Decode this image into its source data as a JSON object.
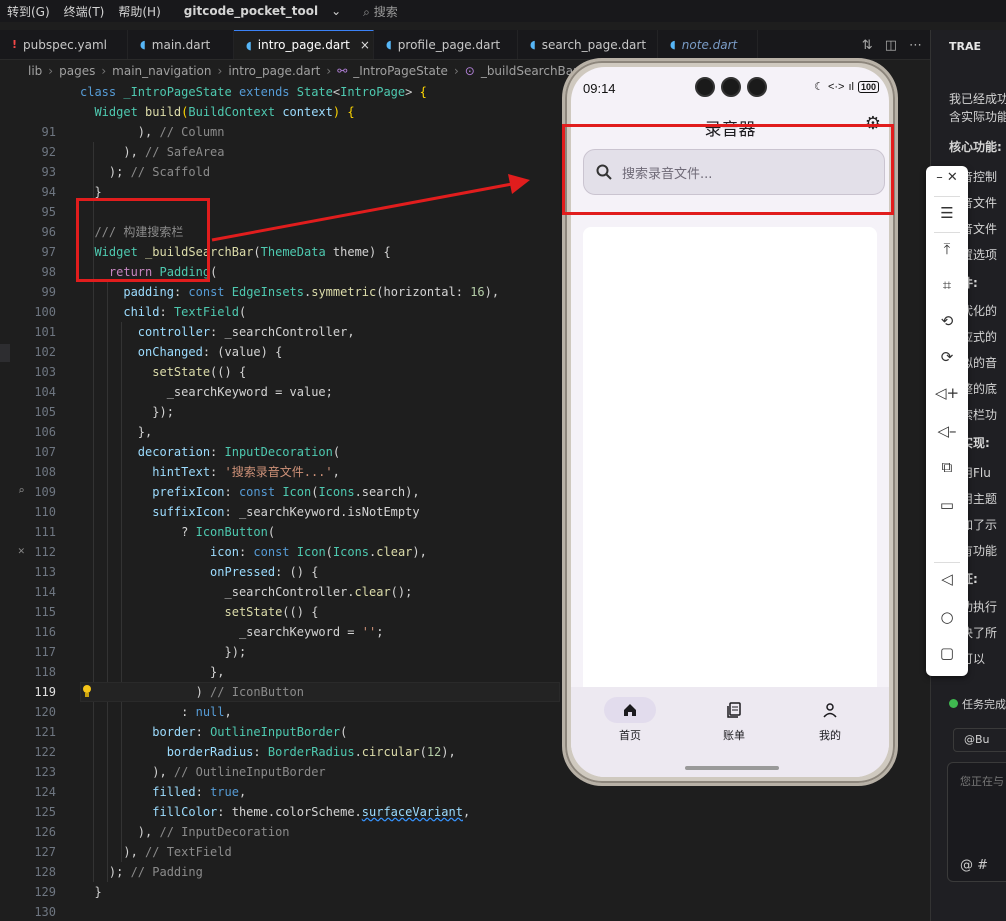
{
  "menu": {
    "items": [
      "转到(G)",
      "终端(T)",
      "帮助(H)"
    ],
    "project": "gitcode_pocket_tool",
    "search": "搜索"
  },
  "tabs": [
    {
      "label": "pubspec.yaml",
      "icon": "!"
    },
    {
      "label": "main.dart",
      "icon": "◖"
    },
    {
      "label": "intro_page.dart",
      "icon": "◖",
      "close": "×"
    },
    {
      "label": "profile_page.dart",
      "icon": "◖"
    },
    {
      "label": "search_page.dart",
      "icon": "◖"
    },
    {
      "label": "note.dart",
      "icon": "◖"
    }
  ],
  "breadcrumb": [
    "lib",
    "pages",
    "main_navigation",
    "intro_page.dart",
    "_IntroPageState",
    "_buildSearchBar"
  ],
  "sticky": {
    "line1": "class _IntroPageState extends State<IntroPage> {",
    "line2": "  Widget build(BuildContext context) {"
  },
  "code": {
    "lines": [
      {
        "n": "91",
        "t": "        ), // Column"
      },
      {
        "n": "92",
        "t": "      ), // SafeArea"
      },
      {
        "n": "93",
        "t": "    ); // Scaffold"
      },
      {
        "n": "94",
        "t": "  }"
      },
      {
        "n": "95",
        "t": ""
      },
      {
        "n": "96",
        "t": "  /// 构建搜索栏"
      },
      {
        "n": "97",
        "t": "  Widget _buildSearchBar(ThemeData theme) {"
      },
      {
        "n": "98",
        "t": "    return Padding("
      },
      {
        "n": "99",
        "t": "      padding: const EdgeInsets.symmetric(horizontal: 16),"
      },
      {
        "n": "100",
        "t": "      child: TextField("
      },
      {
        "n": "101",
        "t": "        controller: _searchController,"
      },
      {
        "n": "102",
        "t": "        onChanged: (value) {"
      },
      {
        "n": "103",
        "t": "          setState(() {"
      },
      {
        "n": "104",
        "t": "            _searchKeyword = value;"
      },
      {
        "n": "105",
        "t": "          });"
      },
      {
        "n": "106",
        "t": "        },"
      },
      {
        "n": "107",
        "t": "        decoration: InputDecoration("
      },
      {
        "n": "108",
        "t": "          hintText: '搜索录音文件...',"
      },
      {
        "n": "109",
        "t": "          prefixIcon: const Icon(Icons.search),"
      },
      {
        "n": "110",
        "t": "          suffixIcon: _searchKeyword.isNotEmpty"
      },
      {
        "n": "111",
        "t": "              ? IconButton("
      },
      {
        "n": "112",
        "t": "                  icon: const Icon(Icons.clear),"
      },
      {
        "n": "113",
        "t": "                  onPressed: () {"
      },
      {
        "n": "114",
        "t": "                    _searchController.clear();"
      },
      {
        "n": "115",
        "t": "                    setState(() {"
      },
      {
        "n": "116",
        "t": "                      _searchKeyword = '';"
      },
      {
        "n": "117",
        "t": "                    });"
      },
      {
        "n": "118",
        "t": "                  },"
      },
      {
        "n": "119",
        "t": "                ) // IconButton"
      },
      {
        "n": "120",
        "t": "              : null,"
      },
      {
        "n": "121",
        "t": "          border: OutlineInputBorder("
      },
      {
        "n": "122",
        "t": "            borderRadius: BorderRadius.circular(12),"
      },
      {
        "n": "123",
        "t": "          ), // OutlineInputBorder"
      },
      {
        "n": "124",
        "t": "          filled: true,"
      },
      {
        "n": "125",
        "t": "          fillColor: theme.colorScheme.surfaceVariant,"
      },
      {
        "n": "126",
        "t": "        ), // InputDecoration"
      },
      {
        "n": "127",
        "t": "      ), // TextField"
      },
      {
        "n": "128",
        "t": "    ); // Padding"
      },
      {
        "n": "129",
        "t": "  }"
      },
      {
        "n": "130",
        "t": ""
      }
    ]
  },
  "phone": {
    "time": "09:14",
    "battery": "100",
    "title": "录音器",
    "search_placeholder": "搜索录音文件...",
    "nav": [
      {
        "label": "首页",
        "icon": "home-icon"
      },
      {
        "label": "账单",
        "icon": "bill-icon"
      },
      {
        "label": "我的",
        "icon": "person-icon"
      }
    ]
  },
  "panel": {
    "title": "TRAE",
    "lines": [
      "我已经成功",
      "含实际功能",
      "核心功能:",
      "录音控制",
      "录音文件",
      "录音文件",
      "设置选项",
      "组件:",
      "现代化的",
      "响应式的",
      "模拟的音",
      "完整的底",
      "搜索栏功",
      "术实现:",
      "使用Flu",
      "采用主题",
      "添加了示",
      "所有功能",
      "验证:",
      "成功执行",
      "解决了所",
      "您可以",
      "任务完成"
    ],
    "input_placeholder": "您正在与",
    "chip": "@Bu",
    "bottom_icons": "@  #"
  },
  "colors": {
    "accent_red": "#e11d1d",
    "editor_bg": "#1e1e1e",
    "phone_bg": "#f5f2f8"
  }
}
